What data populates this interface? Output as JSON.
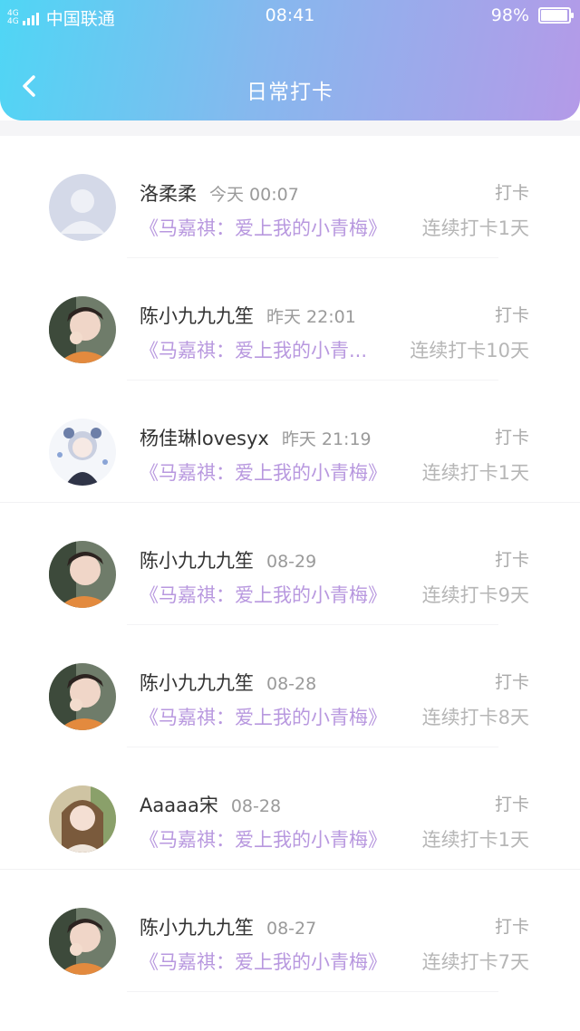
{
  "status_bar": {
    "network": "4G",
    "carrier": "中国联通",
    "time": "08:41",
    "battery_text": "98%",
    "battery_level": 0.98
  },
  "header": {
    "back_icon": "chevron-left-icon",
    "title": "日常打卡"
  },
  "colors": {
    "header_gradient_start": "#4fd6f5",
    "header_gradient_end": "#b49ae8",
    "course_link": "#b898df",
    "meta_text": "#9a9a9a"
  },
  "items": [
    {
      "name": "洛柔柔",
      "time": "今天 00:07",
      "action": "打卡",
      "course": "《马嘉祺：爱上我的小青梅》",
      "streak": "连续打卡1天",
      "avatar": "default-avatar"
    },
    {
      "name": "陈小九九九笙",
      "time": "昨天 22:01",
      "action": "打卡",
      "course": "《马嘉祺：爱上我的小青...",
      "streak": "连续打卡10天",
      "avatar": "photo-avatar"
    },
    {
      "name": "杨佳琳lovesyx",
      "time": "昨天 21:19",
      "action": "打卡",
      "course": "《马嘉祺：爱上我的小青梅》",
      "streak": "连续打卡1天",
      "avatar": "anime-avatar"
    },
    {
      "name": "陈小九九九笙",
      "time": "08-29",
      "action": "打卡",
      "course": "《马嘉祺：爱上我的小青梅》",
      "streak": "连续打卡9天",
      "avatar": "photo-avatar"
    },
    {
      "name": "陈小九九九笙",
      "time": "08-28",
      "action": "打卡",
      "course": "《马嘉祺：爱上我的小青梅》",
      "streak": "连续打卡8天",
      "avatar": "photo-avatar"
    },
    {
      "name": "Aaaaa宋",
      "time": "08-28",
      "action": "打卡",
      "course": "《马嘉祺：爱上我的小青梅》",
      "streak": "连续打卡1天",
      "avatar": "photo-avatar"
    },
    {
      "name": "陈小九九九笙",
      "time": "08-27",
      "action": "打卡",
      "course": "《马嘉祺：爱上我的小青梅》",
      "streak": "连续打卡7天",
      "avatar": "photo-avatar"
    }
  ]
}
